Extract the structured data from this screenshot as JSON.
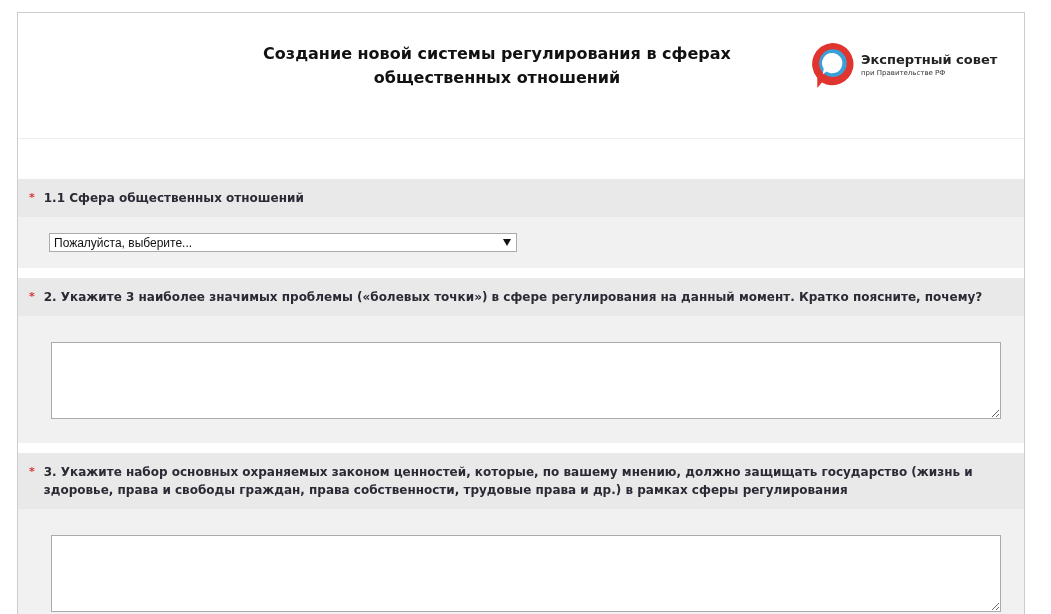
{
  "header": {
    "title": "Создание новой системы регулирования в сферах общественных отношений",
    "logo": {
      "name": "Экспертный совет",
      "subtitle": "при Правительстве РФ"
    }
  },
  "questions": [
    {
      "kind": "select",
      "required_mark": "*",
      "label": "1.1 Сфера общественных отношений",
      "placeholder": "Пожалуйста, выберите..."
    },
    {
      "kind": "textarea",
      "required_mark": "*",
      "label": "2. Укажите 3 наиболее значимых проблемы («болевых точки») в сфере регулирования на данный момент. Кратко поясните, почему?"
    },
    {
      "kind": "textarea",
      "required_mark": "*",
      "label": "3. Укажите набор основных охраняемых законом ценностей, которые, по вашему мнению, должно защищать государство (жизнь и здоровье, права и свободы граждан, права собственности, трудовые права и др.) в рамках сферы регулирования"
    }
  ]
}
